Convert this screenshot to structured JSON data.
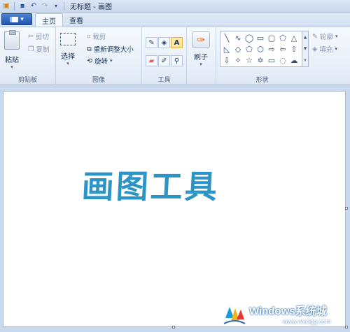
{
  "window": {
    "title": "无标题 - 画图"
  },
  "quick_access": {
    "icons": [
      "app-icon",
      "save-icon",
      "undo-icon",
      "redo-icon",
      "customize-icon"
    ]
  },
  "file_menu": {
    "label": "▾"
  },
  "tabs": [
    {
      "label": "主页",
      "active": true
    },
    {
      "label": "查看",
      "active": false
    }
  ],
  "clipboard": {
    "paste_label": "粘贴",
    "cut_label": "剪切",
    "copy_label": "复制",
    "group_label": "剪贴板"
  },
  "image": {
    "select_label": "选择",
    "crop_label": "裁剪",
    "resize_label": "重新调整大小",
    "rotate_label": "旋转",
    "group_label": "图像"
  },
  "tools": {
    "group_label": "工具",
    "items": [
      "pencil-icon",
      "fill-icon",
      "text-icon",
      "eraser-icon",
      "color-picker-icon",
      "magnifier-icon"
    ],
    "active": "text-icon"
  },
  "brushes": {
    "label": "刷子"
  },
  "shapes": {
    "outline_label": "轮廓",
    "fill_label": "填充",
    "group_label": "形状"
  },
  "canvas": {
    "art_text": "画图工具"
  },
  "watermark": {
    "title": "Windows系统城",
    "url": "www.wxclgg.com"
  },
  "colors": {
    "accent": "#2d95c5",
    "ribbon": "#e7eef8",
    "workspace": "#c9d9ee"
  }
}
